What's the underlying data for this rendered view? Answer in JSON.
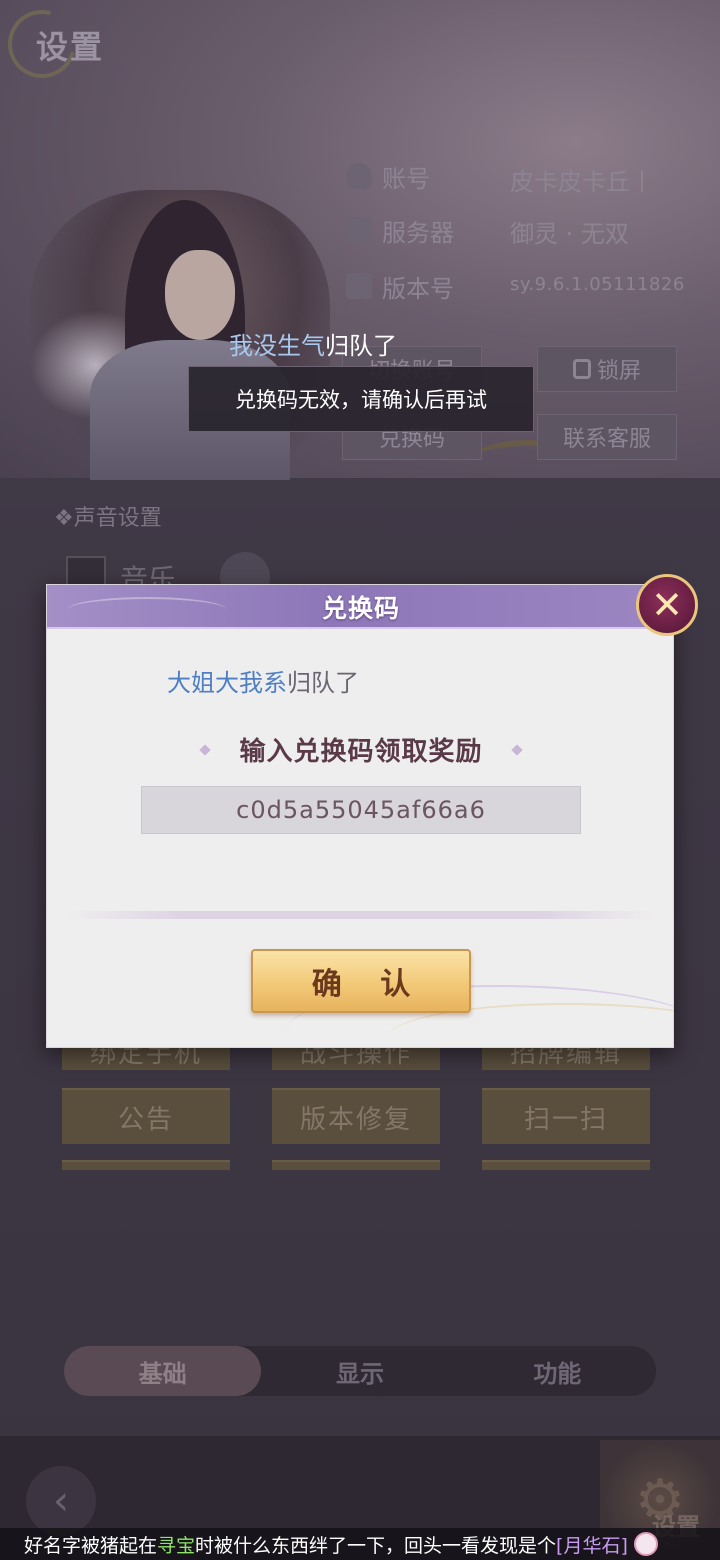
{
  "settings": {
    "title": "设置",
    "account_label": "账号",
    "account_value": "皮卡皮卡丘丨",
    "server_label": "服务器",
    "server_value": "御灵 · 无双",
    "version_label": "版本号",
    "version_value": "sy.9.6.1.05111826",
    "buttons": {
      "switch_account": "切换账号",
      "lock_screen": "锁屏",
      "redeem_code": "兑换码",
      "contact_support": "联系客服"
    },
    "sound_heading": "声音设置",
    "music_label": "音乐",
    "grid": {
      "row1": [
        "绑定手机",
        "战斗操作",
        "招牌编辑"
      ],
      "row2": [
        "公告",
        "版本修复",
        "扫一扫"
      ]
    },
    "tabs": [
      "基础",
      "显示",
      "功能"
    ],
    "active_tab": "基础",
    "corner_label": "设置"
  },
  "toast": {
    "player_name": "我没生气",
    "action": "归队了",
    "message": "兑换码无效，请确认后再试"
  },
  "modal": {
    "title": "兑换码",
    "player_name": "大姐大我系",
    "action": "归队了",
    "subtitle": "输入兑换码领取奖励",
    "code_value": "c0d5a55045af66a6",
    "confirm_label": "确 认"
  },
  "marquee": {
    "part1": "好名字被猪起在",
    "highlight1": "寻宝",
    "part2": "时被什么东西绊了一下，回头一看发现是个",
    "highlight2": "[月华石]"
  },
  "colors": {
    "modal_header": "#8d77b8",
    "confirm_gold": "#f2c978",
    "toast_bg": "#28242c"
  },
  "icons": {
    "close": "close-icon",
    "back": "back-arrow-icon",
    "gear": "gear-icon",
    "lock": "lock-icon"
  }
}
